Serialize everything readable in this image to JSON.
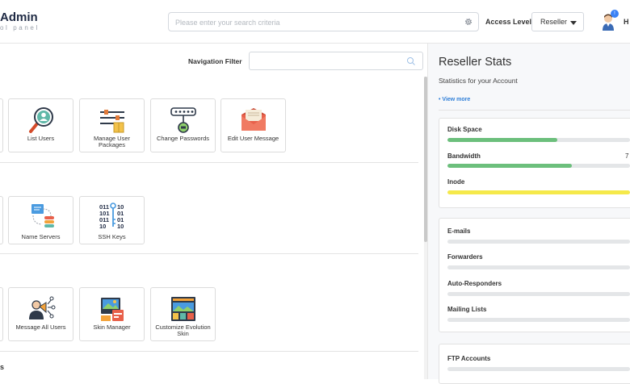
{
  "header": {
    "logo_title": "Admin",
    "logo_subtitle": "ol panel",
    "search_placeholder": "Please enter your search criteria",
    "access_level_label": "Access Level",
    "access_level_value": "Reseller",
    "avatar_badge": "!",
    "user_initial": "H"
  },
  "navigation_filter": {
    "label": "Navigation Filter",
    "value": ""
  },
  "sections": [
    {
      "tiles": [
        "List Users",
        "Manage User Packages",
        "Change Passwords",
        "Edit User Message"
      ]
    },
    {
      "tiles": [
        "Name Servers",
        "SSH Keys"
      ]
    },
    {
      "tiles": [
        "Message All Users",
        "Skin Manager",
        "Customize Evolution Skin"
      ]
    }
  ],
  "cut_section_letter": "s",
  "ssh_icon_text": [
    "011",
    "10",
    "101",
    "01",
    "011",
    "01",
    "10",
    "10"
  ],
  "reseller_stats": {
    "title": "Reseller Stats",
    "subtitle": "Statistics for your Account",
    "view_more": "• View more",
    "group1": [
      {
        "label": "Disk Space",
        "value": "",
        "fraction": 0.6,
        "color": "#6cbf7c"
      },
      {
        "label": "Bandwidth",
        "value": "7",
        "fraction": 0.68,
        "color": "#6cbf7c"
      },
      {
        "label": "Inode",
        "value": "",
        "fraction": 1.0,
        "color": "#f5e94a"
      }
    ],
    "group2": [
      {
        "label": "E-mails",
        "fraction": 0
      },
      {
        "label": "Forwarders",
        "fraction": 0
      },
      {
        "label": "Auto-Responders",
        "fraction": 0
      },
      {
        "label": "Mailing Lists",
        "fraction": 0
      }
    ],
    "group3": [
      {
        "label": "FTP Accounts",
        "fraction": 0
      }
    ]
  }
}
